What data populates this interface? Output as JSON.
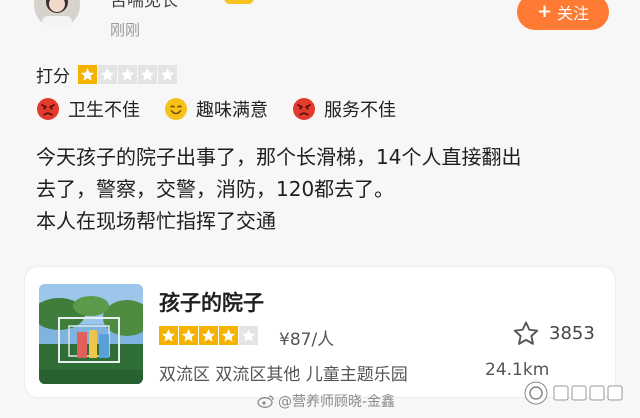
{
  "header": {
    "username": "舌喘见长",
    "post_time": "刚刚",
    "follow_label": "关注"
  },
  "rating": {
    "label": "打分",
    "score": 1,
    "max": 5
  },
  "tags": [
    {
      "label": "卫生不佳",
      "icon": "angry-face-icon"
    },
    {
      "label": "趣味满意",
      "icon": "smile-face-icon"
    },
    {
      "label": "服务不佳",
      "icon": "angry-face-icon"
    }
  ],
  "review": {
    "line1": "今天孩子的院子出事了，那个长滑梯，14个人直接翻出",
    "line2": "去了，警察，交警，消防，120都去了。",
    "line3": "本人在现场帮忙指挥了交通"
  },
  "poi": {
    "name": "孩子的院子",
    "star_rating": 4,
    "star_max": 5,
    "price": "¥87/人",
    "favorites": "3853",
    "meta": "双流区  双流区其他  儿童主题乐园",
    "distance": "24.1km"
  },
  "watermark": {
    "text": "@营养师顾晓-金鑫"
  },
  "colors": {
    "accent": "#ff7a33",
    "star": "#f5b300",
    "angry": "#e23b2e",
    "smile": "#f7c21a"
  }
}
